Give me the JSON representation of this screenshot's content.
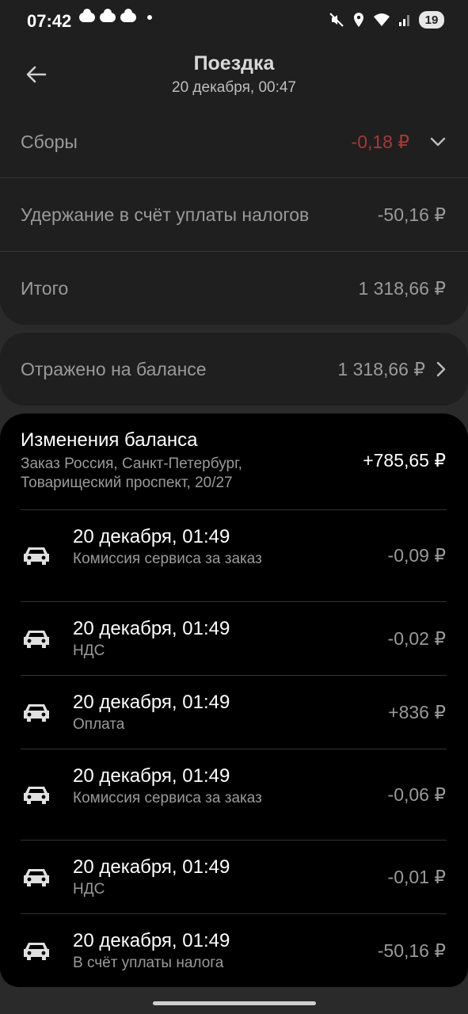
{
  "status_bar": {
    "time": "07:42",
    "battery": "19"
  },
  "header": {
    "title": "Поездка",
    "subtitle": "20 декабря, 00:47"
  },
  "summary": {
    "fees": {
      "label": "Сборы",
      "value": "-0,18 ₽"
    },
    "tax_hold": {
      "label": "Удержание в счёт уплаты налогов",
      "value": "-50,16 ₽"
    },
    "total": {
      "label": "Итого",
      "value": "1 318,66 ₽"
    }
  },
  "balance": {
    "label": "Отражено на балансе",
    "value": "1 318,66 ₽"
  },
  "changes": {
    "title": "Изменения баланса",
    "address": "Заказ Россия, Санкт-Петербург, Товарищеский проспект, 20/27",
    "total": "+785,65 ₽",
    "items": [
      {
        "date": "20 декабря, 01:49",
        "desc": "Комиссия сервиса за заказ",
        "amount": "-0,09 ₽"
      },
      {
        "date": "20 декабря, 01:49",
        "desc": "НДС",
        "amount": "-0,02 ₽"
      },
      {
        "date": "20 декабря, 01:49",
        "desc": "Оплата",
        "amount": "+836 ₽"
      },
      {
        "date": "20 декабря, 01:49",
        "desc": "Комиссия сервиса за заказ",
        "amount": "-0,06 ₽"
      },
      {
        "date": "20 декабря, 01:49",
        "desc": "НДС",
        "amount": "-0,01 ₽"
      },
      {
        "date": "20 декабря, 01:49",
        "desc": "В счёт уплаты налога",
        "amount": "-50,16 ₽"
      }
    ]
  },
  "colors": {
    "negative": "#a83838",
    "background": "#1f1f1f",
    "list_bg": "#000000"
  },
  "icons": [
    "back-arrow-icon",
    "chevron-down-icon",
    "chevron-right-icon",
    "taxi-car-icon"
  ]
}
